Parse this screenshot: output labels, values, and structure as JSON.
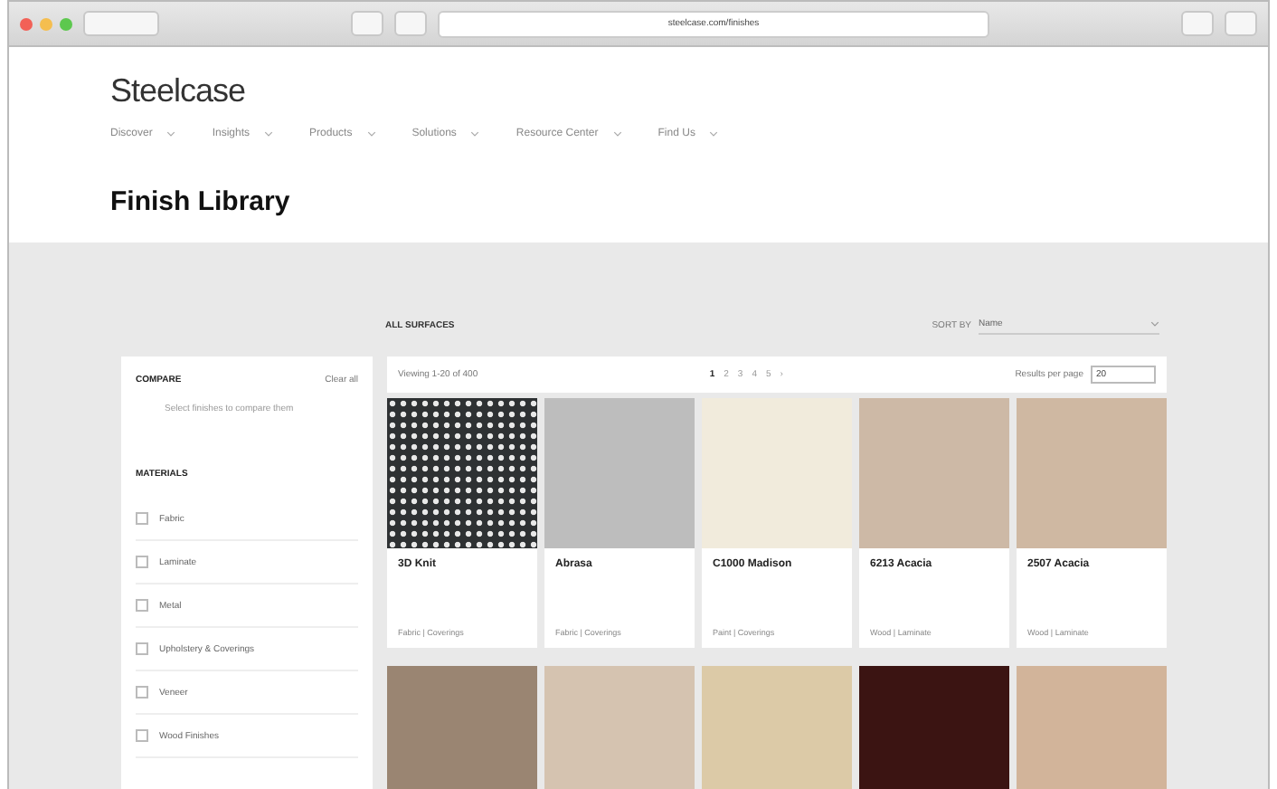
{
  "browser": {
    "url": "steelcase.com/finishes"
  },
  "site": {
    "logo": "Steelcase",
    "nav": [
      {
        "label": "Discover"
      },
      {
        "label": "Insights"
      },
      {
        "label": "Products"
      },
      {
        "label": "Solutions"
      },
      {
        "label": "Resource Center"
      },
      {
        "label": "Find Us"
      }
    ]
  },
  "page_title": "Finish Library",
  "sidebar": {
    "compare_heading": "COMPARE",
    "compare_action": "Clear all",
    "compare_hint": "Select finishes to compare them",
    "materials_heading": "MATERIALS",
    "items": [
      {
        "label": "Fabric",
        "checked": false
      },
      {
        "label": "Laminate",
        "checked": false
      },
      {
        "label": "Metal",
        "checked": false
      },
      {
        "label": "Upholstery & Coverings",
        "checked": false
      },
      {
        "label": "Veneer",
        "checked": false
      },
      {
        "label": "Wood Finishes",
        "checked": false
      }
    ]
  },
  "results": {
    "heading": "ALL SURFACES",
    "sort_label": "SORT BY",
    "sort_value": "Name",
    "count": "Viewing 1-20 of 400",
    "pages": [
      {
        "label": "1",
        "selected": true
      },
      {
        "label": "2",
        "selected": false
      },
      {
        "label": "3",
        "selected": false
      },
      {
        "label": "4",
        "selected": false
      },
      {
        "label": "5",
        "selected": false
      },
      {
        "label": "›",
        "selected": false
      }
    ],
    "per_page_label": "Results per page",
    "per_page_value": "20",
    "tiles": [
      {
        "name": "3D Knit",
        "kind": "pattern",
        "color": "#2e3133",
        "meta": "Fabric | Coverings"
      },
      {
        "name": "Abrasa",
        "kind": "solid",
        "color": "#bdbdbd",
        "meta": "Fabric | Coverings"
      },
      {
        "name": "C1000 Madison",
        "kind": "solid",
        "color": "#f1ebdc",
        "meta": "Paint | Coverings"
      },
      {
        "name": "6213 Acacia",
        "kind": "solid",
        "color": "#cdb9a6",
        "meta": "Wood | Laminate"
      },
      {
        "name": "2507 Acacia",
        "kind": "solid",
        "color": "#cfb8a2",
        "meta": "Wood | Laminate"
      },
      {
        "kind": "solid",
        "color": "#9a8572"
      },
      {
        "kind": "solid",
        "color": "#d5c3b0"
      },
      {
        "kind": "solid",
        "color": "#dccaa7"
      },
      {
        "kind": "solid",
        "color": "#3b1412"
      },
      {
        "kind": "solid",
        "color": "#d2b49a"
      }
    ]
  }
}
